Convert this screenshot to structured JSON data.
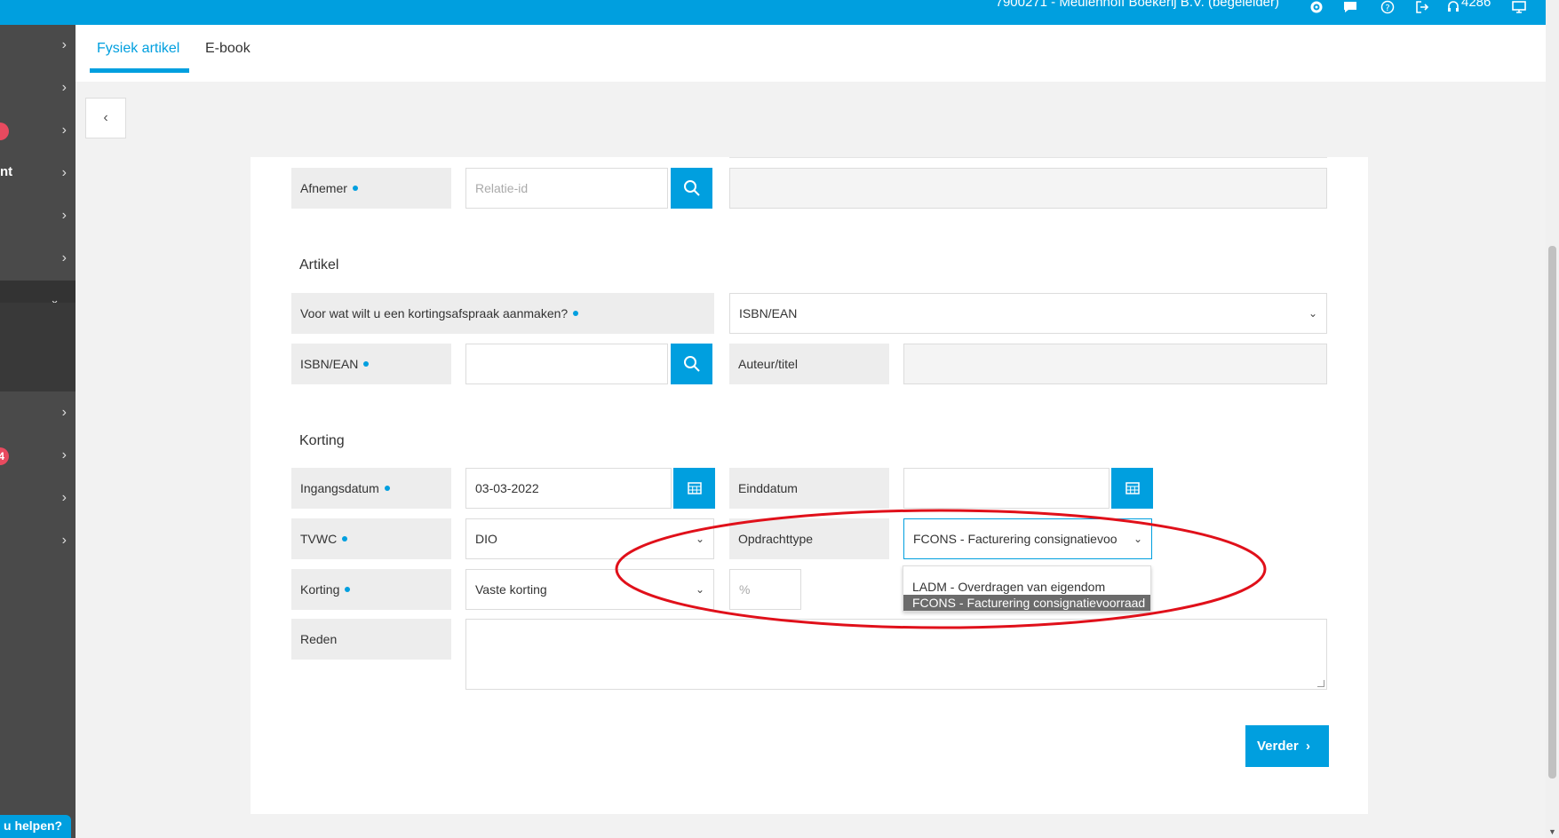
{
  "topbar": {
    "company": "7900271 - Meulenhoff Boekerij B.V. (begeleider)",
    "count": "4286",
    "icons": [
      "gear-icon",
      "chat-icon",
      "help-icon",
      "logout-icon",
      "headset-icon",
      "monitor-icon"
    ]
  },
  "sidebar": {
    "fragment": "nt",
    "badges": [
      "",
      "4"
    ],
    "help_label": "u helpen?"
  },
  "tabs": {
    "items": [
      {
        "label": "Fysiek artikel",
        "active": true
      },
      {
        "label": "E-book",
        "active": false
      }
    ]
  },
  "form": {
    "afnemer": {
      "label": "Afnemer",
      "placeholder": "Relatie-id"
    },
    "artikel": {
      "title": "Artikel",
      "question_label": "Voor wat wilt u een kortingsafspraak aanmaken?",
      "question_value": "ISBN/EAN",
      "isbn_label": "ISBN/EAN",
      "auteur_label": "Auteur/titel"
    },
    "korting": {
      "title": "Korting",
      "ingangsdatum_label": "Ingangsdatum",
      "ingangsdatum_value": "03-03-2022",
      "einddatum_label": "Einddatum",
      "tvwc_label": "TVWC",
      "tvwc_value": "DIO",
      "opdrachttype_label": "Opdrachttype",
      "opdrachttype_value": "FCONS - Facturering consignatievoo",
      "opdrachttype_options": [
        {
          "label": "LADM - Overdragen van eigendom",
          "selected": false
        },
        {
          "label": "FCONS - Facturering consignatievoorraad",
          "selected": true
        }
      ],
      "korting_label": "Korting",
      "korting_value": "Vaste korting",
      "percent_placeholder": "%",
      "reden_label": "Reden"
    }
  },
  "actions": {
    "verder_label": "Verder"
  },
  "colors": {
    "accent": "#009fdf",
    "highlight_ellipse": "#e0101a",
    "sidebar": "#4a4a4a"
  }
}
